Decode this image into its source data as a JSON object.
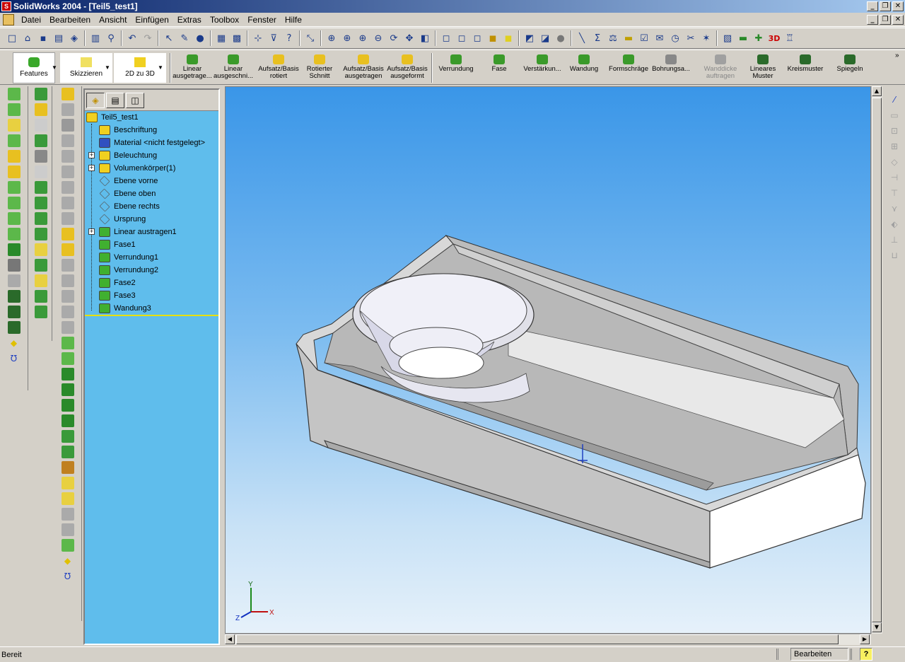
{
  "window": {
    "title": "SolidWorks 2004 - [Teil5_test1]"
  },
  "title_buttons": [
    "_",
    "❐",
    "✕"
  ],
  "menu": [
    "Datei",
    "Bearbeiten",
    "Ansicht",
    "Einfügen",
    "Extras",
    "Toolbox",
    "Fenster",
    "Hilfe"
  ],
  "command_manager": {
    "features_tab": "Features",
    "sketch_tab": "Skizzieren",
    "twod_tab": "2D zu 3D"
  },
  "feature_buttons": [
    {
      "line1": "Linear",
      "line2": "ausgetrage...",
      "color": "#3a9a2a",
      "enabled": true
    },
    {
      "line1": "Linear",
      "line2": "ausgeschni...",
      "color": "#3a9a2a",
      "enabled": true
    },
    {
      "line1": "Aufsatz/Basis",
      "line2": "rotiert",
      "color": "#e8c020",
      "enabled": true
    },
    {
      "line1": "Rotierter",
      "line2": "Schnitt",
      "color": "#e8c020",
      "enabled": true
    },
    {
      "line1": "Aufsatz/Basis",
      "line2": "ausgetragen",
      "color": "#e8c020",
      "enabled": true
    },
    {
      "line1": "Aufsatz/Basis",
      "line2": "ausgeformt",
      "color": "#e8c020",
      "enabled": true
    },
    {
      "line1": "Verrundung",
      "line2": "",
      "color": "#3a9a2a",
      "enabled": true
    },
    {
      "line1": "Fase",
      "line2": "",
      "color": "#3a9a2a",
      "enabled": true
    },
    {
      "line1": "Verstärkun...",
      "line2": "",
      "color": "#3a9a2a",
      "enabled": true
    },
    {
      "line1": "Wandung",
      "line2": "",
      "color": "#3a9a2a",
      "enabled": true
    },
    {
      "line1": "Formschräge",
      "line2": "",
      "color": "#3a9a2a",
      "enabled": true
    },
    {
      "line1": "Bohrungsa...",
      "line2": "",
      "color": "#888888",
      "enabled": true
    },
    {
      "line1": "Wanddicke",
      "line2": "auftragen",
      "color": "#a0a0a0",
      "enabled": false
    },
    {
      "line1": "Lineares",
      "line2": "Muster",
      "color": "#2a6a2a",
      "enabled": true
    },
    {
      "line1": "Kreismuster",
      "line2": "",
      "color": "#2a6a2a",
      "enabled": true
    },
    {
      "line1": "Spiegeln",
      "line2": "",
      "color": "#2a6a2a",
      "enabled": true
    }
  ],
  "feature_manager": {
    "root": "Teil5_test1",
    "items": [
      {
        "label": "Beschriftung",
        "icon": "annotation-icon",
        "color": "#f0d020",
        "expand": false
      },
      {
        "label": "Material <nicht festgelegt>",
        "icon": "material-icon",
        "color": "#3050c0",
        "expand": false
      },
      {
        "label": "Beleuchtung",
        "icon": "lighting-icon",
        "color": "#f0d020",
        "expand": true
      },
      {
        "label": "Volumenkörper(1)",
        "icon": "solid-bodies-icon",
        "color": "#f0d020",
        "expand": true
      },
      {
        "label": "Ebene vorne",
        "icon": "plane-icon",
        "color": "none",
        "expand": false
      },
      {
        "label": "Ebene oben",
        "icon": "plane-icon",
        "color": "none",
        "expand": false
      },
      {
        "label": "Ebene rechts",
        "icon": "plane-icon",
        "color": "none",
        "expand": false
      },
      {
        "label": "Ursprung",
        "icon": "origin-icon",
        "color": "none",
        "expand": false
      },
      {
        "label": "Linear austragen1",
        "icon": "extrude-icon",
        "color": "#40b030",
        "expand": true
      },
      {
        "label": "Fase1",
        "icon": "chamfer-icon",
        "color": "#40b030",
        "expand": false
      },
      {
        "label": "Verrundung1",
        "icon": "fillet-icon",
        "color": "#40b030",
        "expand": false
      },
      {
        "label": "Verrundung2",
        "icon": "fillet-icon",
        "color": "#40b030",
        "expand": false
      },
      {
        "label": "Fase2",
        "icon": "chamfer-icon",
        "color": "#40b030",
        "expand": false
      },
      {
        "label": "Fase3",
        "icon": "chamfer-icon",
        "color": "#40b030",
        "expand": false
      },
      {
        "label": "Wandung3",
        "icon": "shell-icon",
        "color": "#40b030",
        "expand": false
      }
    ]
  },
  "triad": {
    "x": "X",
    "y": "Y",
    "z": "Z"
  },
  "status": {
    "left": "Bereit",
    "mode": "Bearbeiten Teil",
    "help": "?"
  }
}
